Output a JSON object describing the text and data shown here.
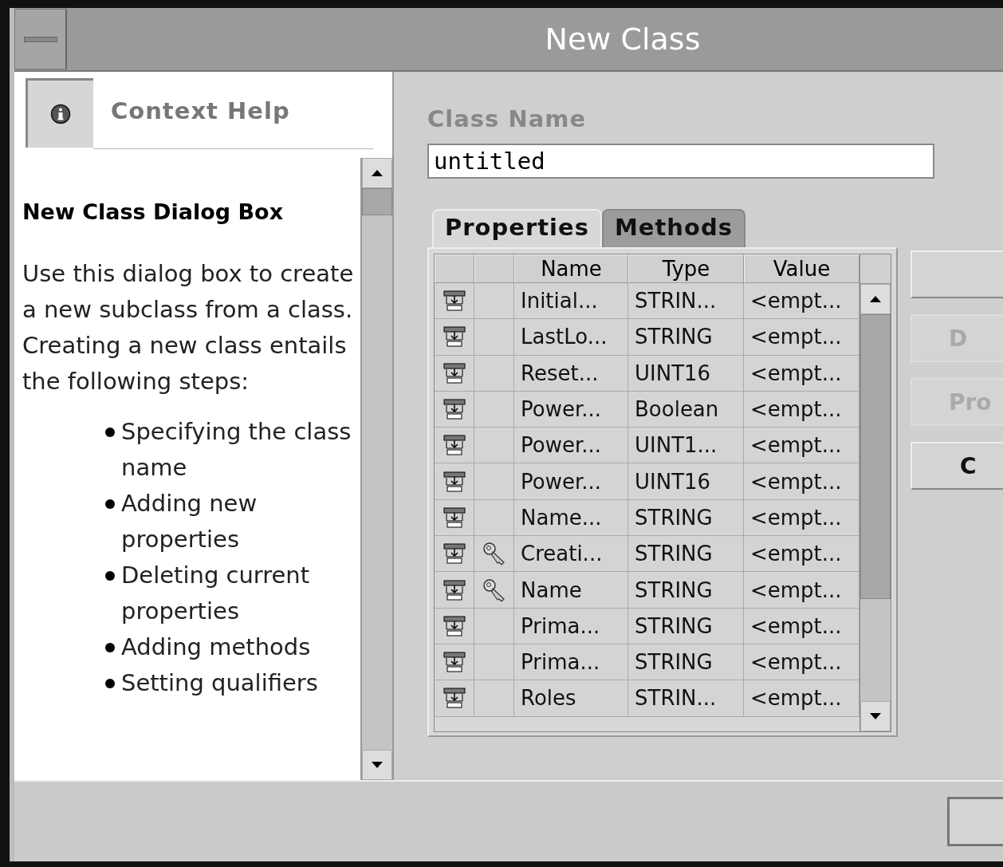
{
  "window": {
    "title": "New Class"
  },
  "help": {
    "header": "Context Help",
    "heading": "New Class Dialog Box",
    "intro": "Use this dialog box to create a new subclass from a class. Creating a new class entails the following steps:",
    "steps": [
      "Specifying the class name",
      "Adding new properties",
      "Deleting current properties",
      "Adding methods",
      "Setting qualifiers"
    ]
  },
  "class_name": {
    "label": "Class Name",
    "value": "untitled"
  },
  "tabs": [
    {
      "label": "Properties",
      "selected": true
    },
    {
      "label": "Methods",
      "selected": false
    }
  ],
  "table": {
    "columns": [
      "Name",
      "Type",
      "Value"
    ],
    "rows": [
      {
        "key": false,
        "cells": [
          "Initial...",
          "STRIN...",
          "<empt..."
        ]
      },
      {
        "key": false,
        "cells": [
          "LastLo...",
          "STRING",
          "<empt..."
        ]
      },
      {
        "key": false,
        "cells": [
          "Reset...",
          "UINT16",
          "<empt..."
        ]
      },
      {
        "key": false,
        "cells": [
          "Power...",
          "Boolean",
          "<empt..."
        ]
      },
      {
        "key": false,
        "cells": [
          "Power...",
          "UINT1...",
          "<empt..."
        ]
      },
      {
        "key": false,
        "cells": [
          "Power...",
          "UINT16",
          "<empt..."
        ]
      },
      {
        "key": false,
        "cells": [
          "Name...",
          "STRING",
          "<empt..."
        ]
      },
      {
        "key": true,
        "cells": [
          "Creati...",
          "STRING",
          "<empt..."
        ]
      },
      {
        "key": true,
        "cells": [
          "Name",
          "STRING",
          "<empt..."
        ]
      },
      {
        "key": false,
        "cells": [
          "Prima...",
          "STRING",
          "<empt..."
        ]
      },
      {
        "key": false,
        "cells": [
          "Prima...",
          "STRING",
          "<empt..."
        ]
      },
      {
        "key": false,
        "cells": [
          "Roles",
          "STRIN...",
          "<empt..."
        ]
      }
    ]
  },
  "side_buttons": [
    {
      "disabled": false
    },
    {
      "label": "D",
      "disabled": true
    },
    {
      "label": "Pro",
      "disabled": true
    },
    {
      "label": "C",
      "disabled": false
    }
  ]
}
